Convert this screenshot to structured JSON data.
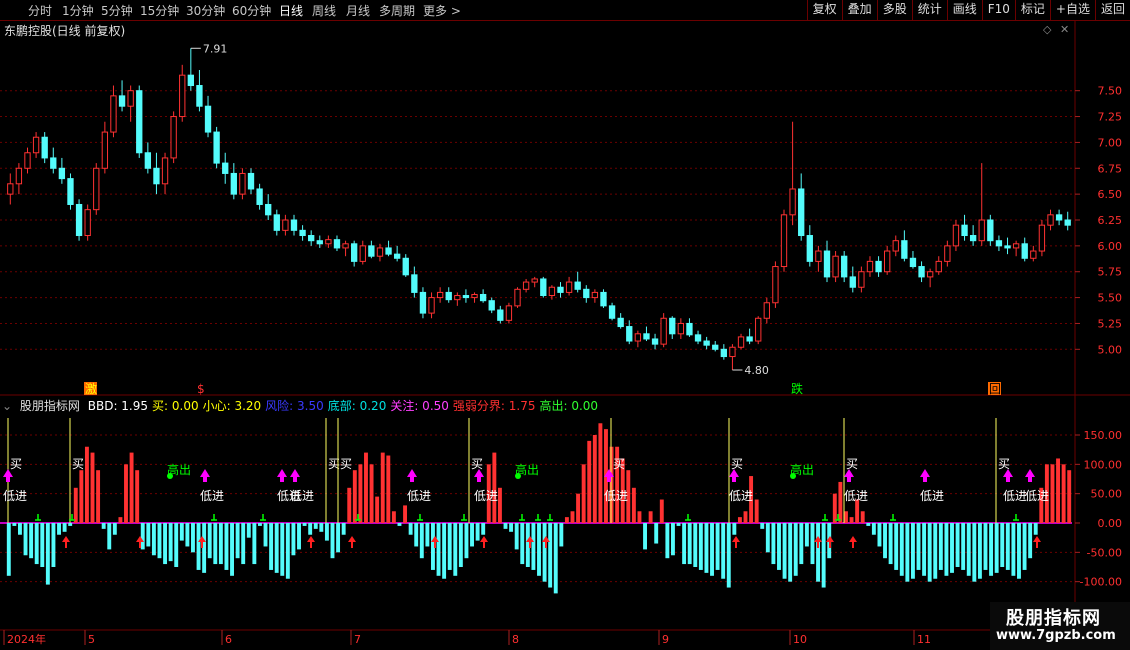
{
  "toolbar": {
    "periods": [
      {
        "label": "分时",
        "active": false
      },
      {
        "label": "1分钟",
        "active": false
      },
      {
        "label": "5分钟",
        "active": false
      },
      {
        "label": "15分钟",
        "active": false
      },
      {
        "label": "30分钟",
        "active": false
      },
      {
        "label": "60分钟",
        "active": false
      },
      {
        "label": "日线",
        "active": true
      },
      {
        "label": "周线",
        "active": false
      },
      {
        "label": "月线",
        "active": false
      },
      {
        "label": "多周期",
        "active": false
      },
      {
        "label": "更多 >",
        "active": false
      }
    ],
    "right_buttons": [
      "复权",
      "叠加",
      "多股",
      "统计",
      "画线",
      "F10",
      "标记",
      "+自选",
      "返回"
    ]
  },
  "stock_title": "东鹏控股(日线 前复权)",
  "price_axis": {
    "labels": [
      "7.50",
      "7.25",
      "7.00",
      "6.75",
      "6.50",
      "6.25",
      "6.00",
      "5.75",
      "5.50",
      "5.25",
      "5.00"
    ],
    "min": 4.8,
    "max": 7.7
  },
  "price_annotations": {
    "high": "7.91",
    "low": "4.80"
  },
  "event_markers": [
    "激",
    "$",
    "跌",
    "回"
  ],
  "indicator": {
    "name": "股朋指标网",
    "values": [
      {
        "label": "BBD: 1.95",
        "color": "#ffffff"
      },
      {
        "label": "买: 0.00",
        "color": "#ffff00"
      },
      {
        "label": "小心: 3.20",
        "color": "#ffff00"
      },
      {
        "label": "风险: 3.50",
        "color": "#3a3aff"
      },
      {
        "label": "底部: 0.20",
        "color": "#00e0e0"
      },
      {
        "label": "关注: 0.50",
        "color": "#ff40ff"
      },
      {
        "label": "强弱分界: 1.75",
        "color": "#ff3030"
      },
      {
        "label": "高出: 0.00",
        "color": "#30ff30"
      }
    ],
    "axis_labels": [
      "150.00",
      "100.00",
      "50.00",
      "0.00",
      "-50.00",
      "-100.00"
    ],
    "signals": {
      "buy": "买",
      "low_in": "低进",
      "high_out": "高出"
    }
  },
  "date_axis": [
    "2024年",
    "5",
    "6",
    "7",
    "8",
    "9",
    "10",
    "11"
  ],
  "watermark": {
    "title": "股朋指标网",
    "url": "www.7gpzb.com"
  },
  "colors": {
    "up": "#ff3232",
    "down": "#54fcfc",
    "grid": "#6b0000",
    "magenta": "#ff00ff",
    "green": "#00ff00"
  },
  "chart_data": [
    {
      "type": "candlestick",
      "title": "东鹏控股(日线 前复权)",
      "ylim": [
        4.8,
        7.7
      ],
      "ohlc": [
        [
          6.5,
          6.7,
          6.4,
          6.6
        ],
        [
          6.6,
          6.8,
          6.5,
          6.75
        ],
        [
          6.75,
          6.95,
          6.7,
          6.9
        ],
        [
          6.9,
          7.1,
          6.85,
          7.05
        ],
        [
          7.05,
          7.1,
          6.8,
          6.85
        ],
        [
          6.85,
          6.95,
          6.7,
          6.75
        ],
        [
          6.75,
          6.85,
          6.6,
          6.65
        ],
        [
          6.65,
          6.7,
          6.35,
          6.4
        ],
        [
          6.4,
          6.45,
          6.05,
          6.1
        ],
        [
          6.1,
          6.4,
          6.05,
          6.35
        ],
        [
          6.35,
          6.8,
          6.3,
          6.75
        ],
        [
          6.75,
          7.2,
          6.7,
          7.1
        ],
        [
          7.1,
          7.55,
          7.05,
          7.45
        ],
        [
          7.45,
          7.6,
          7.3,
          7.35
        ],
        [
          7.35,
          7.55,
          7.2,
          7.5
        ],
        [
          7.5,
          7.55,
          6.85,
          6.9
        ],
        [
          6.9,
          7.0,
          6.7,
          6.75
        ],
        [
          6.75,
          6.9,
          6.5,
          6.6
        ],
        [
          6.6,
          6.9,
          6.5,
          6.85
        ],
        [
          6.85,
          7.3,
          6.8,
          7.25
        ],
        [
          7.25,
          7.75,
          7.2,
          7.65
        ],
        [
          7.65,
          7.91,
          7.5,
          7.55
        ],
        [
          7.55,
          7.7,
          7.3,
          7.35
        ],
        [
          7.35,
          7.45,
          7.05,
          7.1
        ],
        [
          7.1,
          7.15,
          6.75,
          6.8
        ],
        [
          6.8,
          6.9,
          6.6,
          6.7
        ],
        [
          6.7,
          6.8,
          6.45,
          6.5
        ],
        [
          6.5,
          6.75,
          6.45,
          6.7
        ],
        [
          6.7,
          6.75,
          6.5,
          6.55
        ],
        [
          6.55,
          6.6,
          6.35,
          6.4
        ],
        [
          6.4,
          6.5,
          6.25,
          6.3
        ],
        [
          6.3,
          6.35,
          6.1,
          6.15
        ],
        [
          6.15,
          6.3,
          6.1,
          6.25
        ],
        [
          6.25,
          6.3,
          6.1,
          6.15
        ],
        [
          6.15,
          6.2,
          6.05,
          6.1
        ],
        [
          6.1,
          6.15,
          6.0,
          6.05
        ],
        [
          6.05,
          6.1,
          5.98,
          6.02
        ],
        [
          6.02,
          6.1,
          5.98,
          6.06
        ],
        [
          6.06,
          6.1,
          5.95,
          5.98
        ],
        [
          5.98,
          6.05,
          5.9,
          6.02
        ],
        [
          6.02,
          6.05,
          5.8,
          5.85
        ],
        [
          5.85,
          6.05,
          5.82,
          6.0
        ],
        [
          6.0,
          6.05,
          5.88,
          5.9
        ],
        [
          5.9,
          6.02,
          5.85,
          5.98
        ],
        [
          5.98,
          6.05,
          5.9,
          5.92
        ],
        [
          5.92,
          6.0,
          5.85,
          5.88
        ],
        [
          5.88,
          5.92,
          5.7,
          5.72
        ],
        [
          5.72,
          5.8,
          5.5,
          5.55
        ],
        [
          5.55,
          5.6,
          5.3,
          5.35
        ],
        [
          5.35,
          5.55,
          5.3,
          5.5
        ],
        [
          5.5,
          5.6,
          5.45,
          5.55
        ],
        [
          5.55,
          5.6,
          5.45,
          5.48
        ],
        [
          5.48,
          5.55,
          5.42,
          5.52
        ],
        [
          5.52,
          5.58,
          5.45,
          5.5
        ],
        [
          5.5,
          5.55,
          5.45,
          5.53
        ],
        [
          5.53,
          5.58,
          5.45,
          5.47
        ],
        [
          5.47,
          5.5,
          5.35,
          5.38
        ],
        [
          5.38,
          5.42,
          5.25,
          5.28
        ],
        [
          5.28,
          5.45,
          5.25,
          5.42
        ],
        [
          5.42,
          5.6,
          5.4,
          5.58
        ],
        [
          5.58,
          5.68,
          5.55,
          5.65
        ],
        [
          5.65,
          5.7,
          5.6,
          5.68
        ],
        [
          5.68,
          5.7,
          5.5,
          5.52
        ],
        [
          5.52,
          5.62,
          5.48,
          5.6
        ],
        [
          5.6,
          5.65,
          5.5,
          5.55
        ],
        [
          5.55,
          5.7,
          5.52,
          5.65
        ],
        [
          5.65,
          5.75,
          5.55,
          5.58
        ],
        [
          5.58,
          5.62,
          5.45,
          5.5
        ],
        [
          5.5,
          5.58,
          5.45,
          5.55
        ],
        [
          5.55,
          5.58,
          5.4,
          5.42
        ],
        [
          5.42,
          5.45,
          5.28,
          5.3
        ],
        [
          5.3,
          5.35,
          5.2,
          5.22
        ],
        [
          5.22,
          5.28,
          5.05,
          5.08
        ],
        [
          5.08,
          5.18,
          5.02,
          5.15
        ],
        [
          5.15,
          5.22,
          5.08,
          5.1
        ],
        [
          5.1,
          5.15,
          5.0,
          5.05
        ],
        [
          5.05,
          5.35,
          5.02,
          5.3
        ],
        [
          5.3,
          5.32,
          5.1,
          5.15
        ],
        [
          5.15,
          5.3,
          5.1,
          5.25
        ],
        [
          5.25,
          5.3,
          5.12,
          5.14
        ],
        [
          5.14,
          5.18,
          5.05,
          5.08
        ],
        [
          5.08,
          5.12,
          5.0,
          5.04
        ],
        [
          5.04,
          5.08,
          4.98,
          5.0
        ],
        [
          5.0,
          5.05,
          4.9,
          4.93
        ],
        [
          4.93,
          5.05,
          4.8,
          5.02
        ],
        [
          5.02,
          5.15,
          5.0,
          5.12
        ],
        [
          5.12,
          5.2,
          5.05,
          5.08
        ],
        [
          5.08,
          5.32,
          5.05,
          5.3
        ],
        [
          5.3,
          5.5,
          5.25,
          5.45
        ],
        [
          5.45,
          5.85,
          5.4,
          5.8
        ],
        [
          5.8,
          6.35,
          5.75,
          6.3
        ],
        [
          6.3,
          7.2,
          6.2,
          6.55
        ],
        [
          6.55,
          6.7,
          6.05,
          6.1
        ],
        [
          6.1,
          6.2,
          5.8,
          5.85
        ],
        [
          5.85,
          6.0,
          5.75,
          5.95
        ],
        [
          5.95,
          6.05,
          5.65,
          5.7
        ],
        [
          5.7,
          5.95,
          5.65,
          5.9
        ],
        [
          5.9,
          5.95,
          5.65,
          5.7
        ],
        [
          5.7,
          5.8,
          5.55,
          5.6
        ],
        [
          5.6,
          5.8,
          5.55,
          5.75
        ],
        [
          5.75,
          5.9,
          5.7,
          5.85
        ],
        [
          5.85,
          5.9,
          5.7,
          5.75
        ],
        [
          5.75,
          6.0,
          5.72,
          5.95
        ],
        [
          5.95,
          6.1,
          5.9,
          6.05
        ],
        [
          6.05,
          6.15,
          5.85,
          5.88
        ],
        [
          5.88,
          5.95,
          5.78,
          5.8
        ],
        [
          5.8,
          5.85,
          5.65,
          5.7
        ],
        [
          5.7,
          5.78,
          5.6,
          5.75
        ],
        [
          5.75,
          5.9,
          5.72,
          5.85
        ],
        [
          5.85,
          6.05,
          5.8,
          6.0
        ],
        [
          6.0,
          6.25,
          5.95,
          6.2
        ],
        [
          6.2,
          6.3,
          6.05,
          6.1
        ],
        [
          6.1,
          6.2,
          6.0,
          6.05
        ],
        [
          6.05,
          6.8,
          6.0,
          6.25
        ],
        [
          6.25,
          6.3,
          6.0,
          6.05
        ],
        [
          6.05,
          6.1,
          5.95,
          6.0
        ],
        [
          6.0,
          6.08,
          5.92,
          5.98
        ],
        [
          5.98,
          6.05,
          5.9,
          6.02
        ],
        [
          6.02,
          6.08,
          5.85,
          5.88
        ],
        [
          5.88,
          6.0,
          5.85,
          5.95
        ],
        [
          5.95,
          6.25,
          5.9,
          6.2
        ],
        [
          6.2,
          6.35,
          6.15,
          6.3
        ],
        [
          6.3,
          6.35,
          6.2,
          6.25
        ],
        [
          6.25,
          6.33,
          6.15,
          6.2
        ]
      ]
    },
    {
      "type": "bar",
      "title": "股朋指标网",
      "ylim": [
        -105,
        180
      ],
      "values": [
        -90,
        -5,
        -20,
        -55,
        -60,
        -70,
        -75,
        -105,
        -75,
        -20,
        -15,
        -5,
        60,
        90,
        130,
        120,
        90,
        -10,
        -45,
        -20,
        10,
        100,
        120,
        90,
        -45,
        -40,
        -55,
        -60,
        -70,
        -65,
        -75,
        -30,
        -40,
        -50,
        -80,
        -85,
        -60,
        -70,
        -70,
        -80,
        -90,
        -60,
        -70,
        -25,
        -70,
        -5,
        -40,
        -80,
        -85,
        -90,
        -95,
        -55,
        -45,
        -5,
        -20,
        -10,
        -15,
        -30,
        -60,
        -50,
        -20,
        60,
        90,
        100,
        120,
        100,
        45,
        120,
        115,
        20,
        -5,
        30,
        -20,
        -40,
        -60,
        -40,
        -80,
        -90,
        -95,
        -80,
        -90,
        -75,
        -60,
        -40,
        -30,
        -20,
        100,
        120,
        60,
        -10,
        -15,
        -45,
        -70,
        -75,
        -80,
        -90,
        -100,
        -110,
        -120,
        -40,
        10,
        20,
        50,
        100,
        140,
        150,
        170,
        160,
        130,
        130,
        110,
        90,
        60,
        20,
        -45,
        20,
        -35,
        40,
        -60,
        -55,
        -5,
        -70,
        -70,
        -75,
        -80,
        -85,
        -90,
        -80,
        -95,
        -110,
        -20,
        10,
        20,
        80,
        40,
        -10,
        -50,
        -70,
        -80,
        -95,
        -100,
        -90,
        -70,
        -40,
        -70,
        -100,
        -110,
        -60,
        50,
        70,
        20,
        10,
        40,
        20,
        -5,
        -20,
        -40,
        -60,
        -70,
        -80,
        -90,
        -100,
        -95,
        -80,
        -90,
        -100,
        -95,
        -80,
        -90,
        -85,
        -75,
        -80,
        -90,
        -100,
        -95,
        -80,
        -90,
        -85,
        -75,
        -80,
        -90,
        -95,
        -80,
        -60,
        -20,
        60,
        100,
        100,
        110,
        100,
        90
      ],
      "axis_labels": [
        "150.00",
        "100.00",
        "50.00",
        "0.00",
        "-50.00",
        "-100.00"
      ]
    }
  ]
}
